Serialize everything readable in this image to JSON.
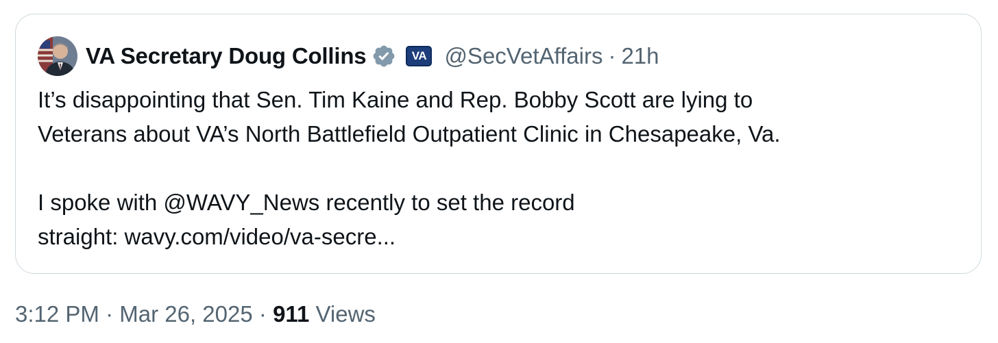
{
  "quoted_tweet": {
    "author": {
      "display_name": "VA Secretary Doug Collins",
      "verified_icon": "verified-badge-icon",
      "affiliation_badge": "VA",
      "handle": "@SecVetAffairs"
    },
    "separator": "·",
    "time_ago": "21h",
    "text_line_1": "It’s disappointing that Sen. Tim Kaine and Rep. Bobby Scott are lying to",
    "text_line_2": "Veterans about VA’s North Battlefield Outpatient Clinic in Chesapeake, Va.",
    "text_line_3": "I spoke with @WAVY_News recently to set the record",
    "text_line_4": "straight: wavy.com/video/va-secre..."
  },
  "meta": {
    "time": "3:12 PM",
    "sep1": "·",
    "date": "Mar 26, 2025",
    "sep2": "·",
    "views_count": "911",
    "views_label": "Views"
  },
  "colors": {
    "text_primary": "#0f1419",
    "text_secondary": "#536471",
    "border": "#cfd9de",
    "verified_badge": "#829aab",
    "affiliation_bg": "#1d3e7a"
  }
}
